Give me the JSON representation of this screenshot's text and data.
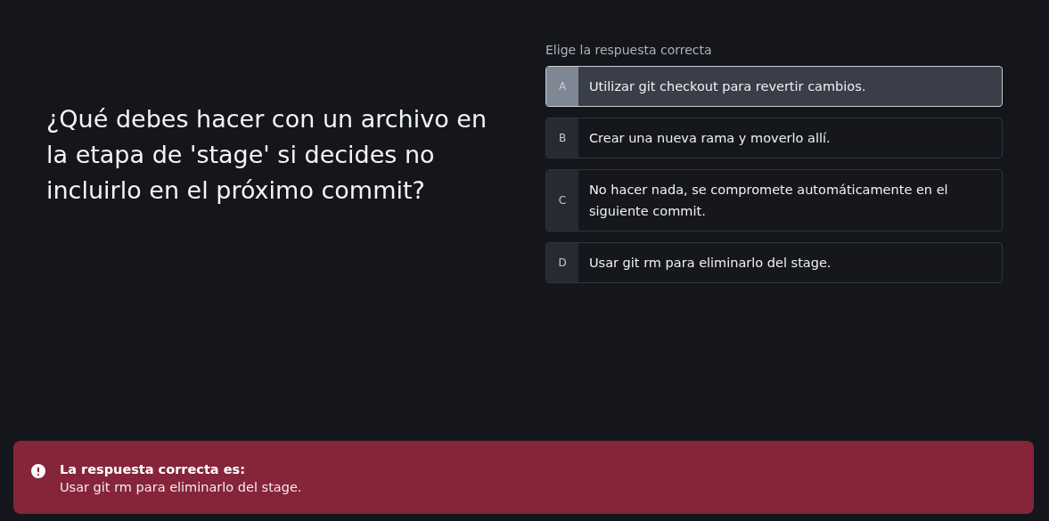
{
  "question": "¿Qué debes hacer con un archivo en la etapa de 'stage' si decides no incluirlo en el próximo commit?",
  "prompt": "Elige la respuesta correcta",
  "options": [
    {
      "letter": "A",
      "text": "Utilizar git checkout para revertir cambios.",
      "selected": true
    },
    {
      "letter": "B",
      "text": "Crear una nueva rama y moverlo allí.",
      "selected": false
    },
    {
      "letter": "C",
      "text": "No hacer nada, se compromete automáticamente en el siguiente commit.",
      "selected": false
    },
    {
      "letter": "D",
      "text": "Usar git rm para eliminarlo del stage.",
      "selected": false
    }
  ],
  "feedback": {
    "kind": "error",
    "title": "La respuesta correcta es:",
    "answer": "Usar git rm para eliminarlo del stage."
  }
}
